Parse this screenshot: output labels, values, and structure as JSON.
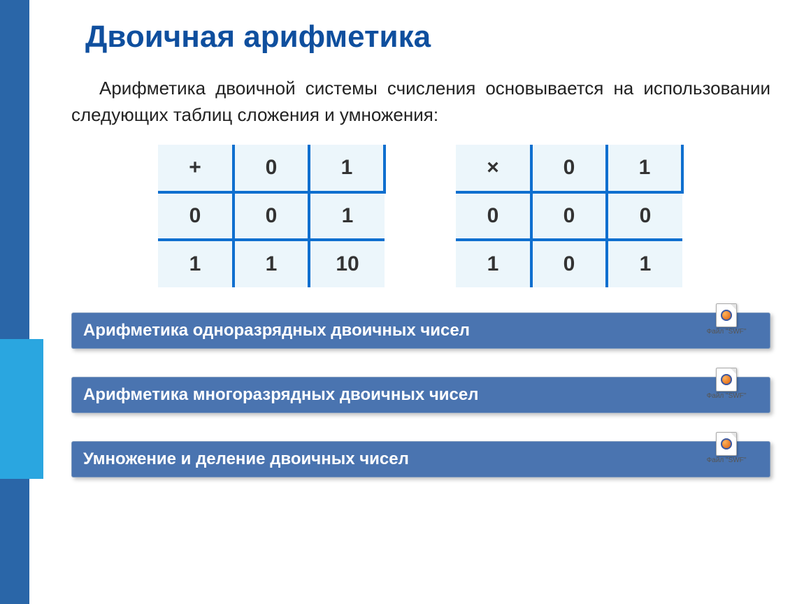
{
  "title": "Двоичная арифметика",
  "intro": "Арифметика двоичной системы счисления основывается на использовании следующих таблиц сложения и умножения:",
  "tables": {
    "addition": {
      "op": "+",
      "headers": [
        "0",
        "1"
      ],
      "rows": [
        [
          "0",
          "0",
          "1"
        ],
        [
          "1",
          "1",
          "10"
        ]
      ]
    },
    "multiplication": {
      "op": "×",
      "headers": [
        "0",
        "1"
      ],
      "rows": [
        [
          "0",
          "0",
          "0"
        ],
        [
          "1",
          "0",
          "1"
        ]
      ]
    }
  },
  "links": [
    {
      "label": "Арифметика одноразрядных двоичных чисел",
      "file_caption": "Файл \"SWF\""
    },
    {
      "label": "Арифметика многоразрядных двоичных чисел",
      "file_caption": "Файл \"SWF\""
    },
    {
      "label": "Умножение и деление двоичных чисел",
      "file_caption": "Файл \"SWF\""
    }
  ]
}
